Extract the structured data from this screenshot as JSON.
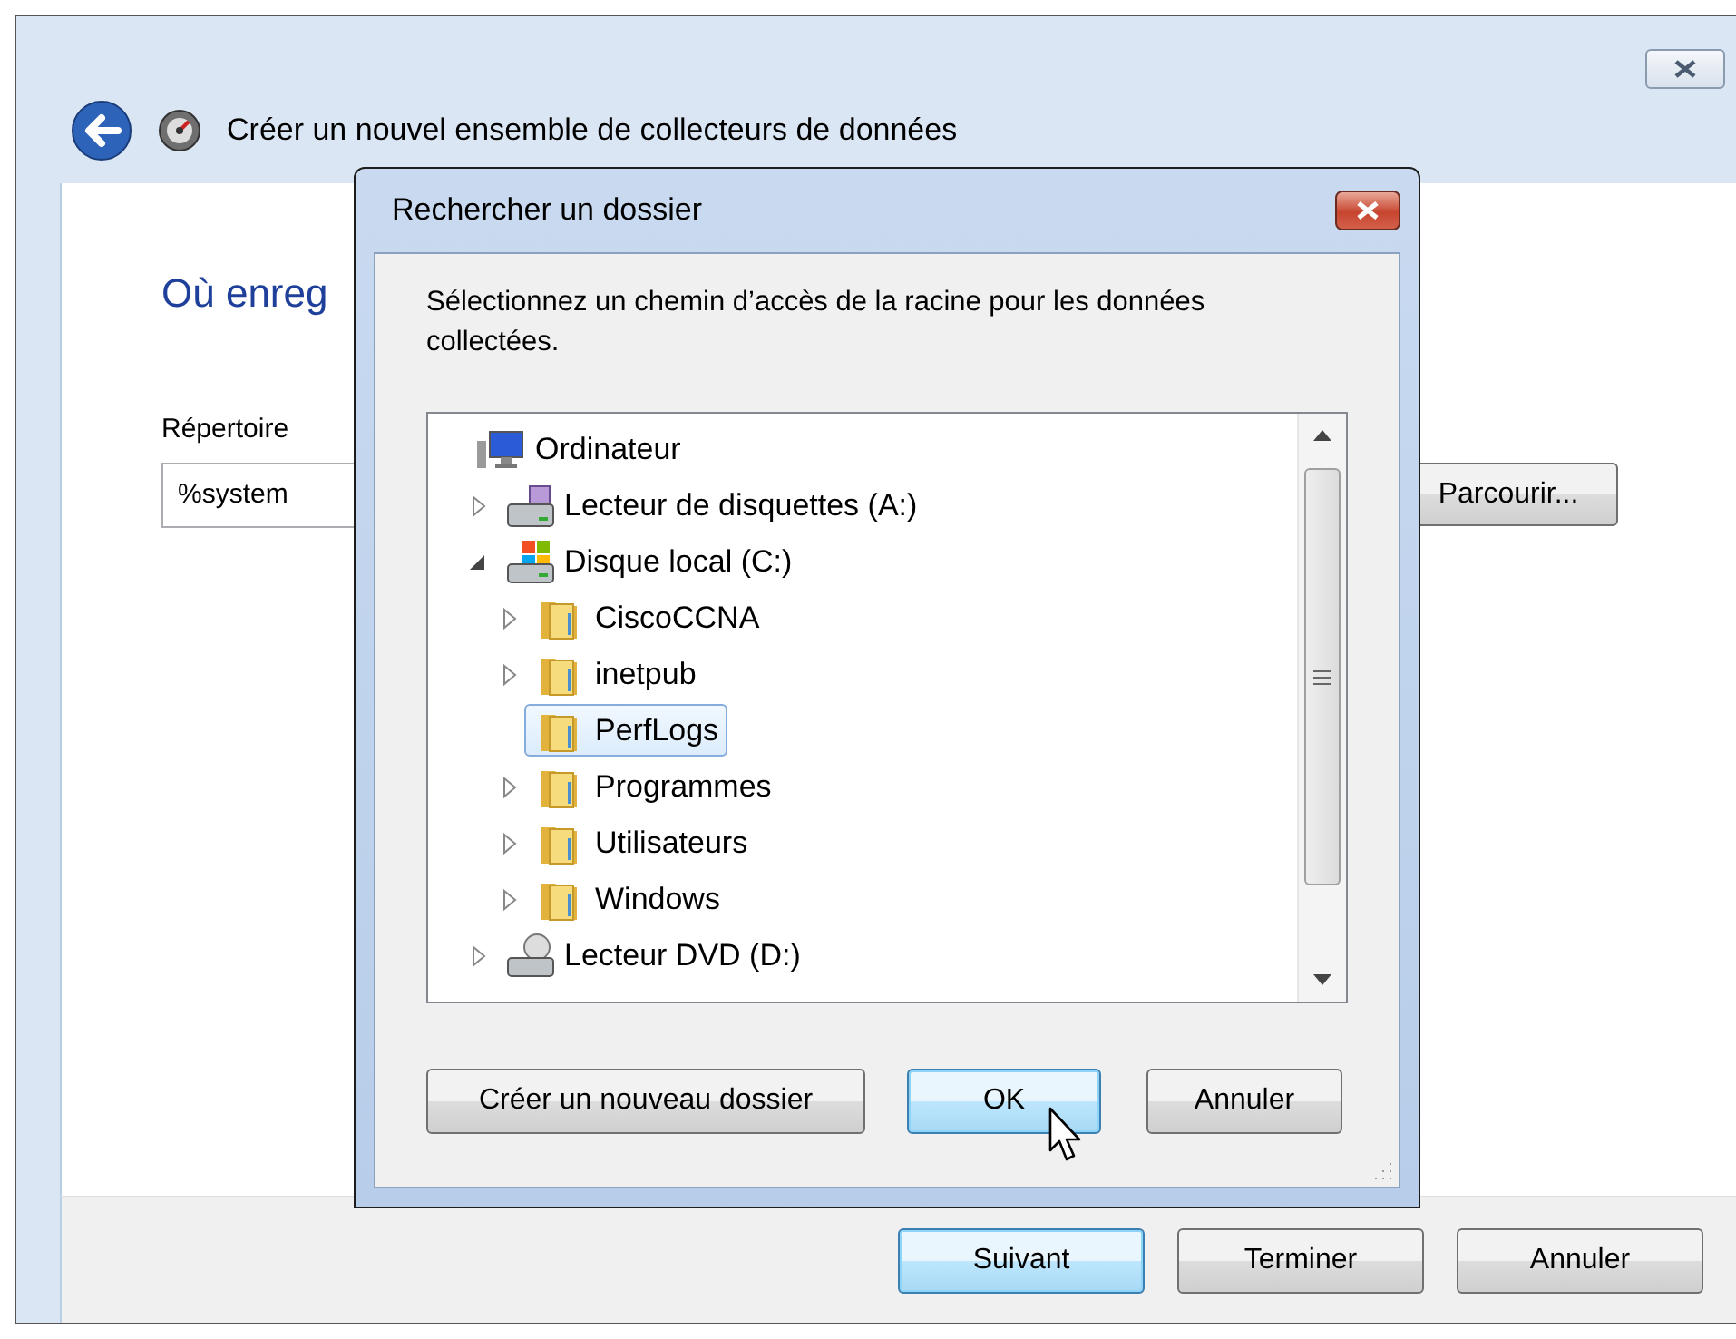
{
  "wizard": {
    "title": "Créer un nouvel ensemble de collecteurs de données",
    "heading": "Où enreg",
    "field_label": "Répertoire",
    "field_value": "%system",
    "browse_button": "Parcourir...",
    "buttons": [
      {
        "label": "Suivant",
        "default": true
      },
      {
        "label": "Terminer",
        "default": false
      },
      {
        "label": "Annuler",
        "default": false
      }
    ]
  },
  "dialog": {
    "title": "Rechercher un dossier",
    "description": "Sélectionnez un chemin d’accès de la racine pour les données collectées.",
    "tree": [
      {
        "label": "Ordinateur",
        "kind": "computer",
        "selected": false,
        "children": [
          {
            "label": "Lecteur de disquettes (A:)",
            "kind": "floppy",
            "selected": false,
            "expanded": false
          },
          {
            "label": "Disque local (C:)",
            "kind": "drive",
            "selected": false,
            "expanded": true,
            "children": [
              {
                "label": "CiscoCCNA",
                "kind": "folder",
                "selected": false,
                "expanded": false
              },
              {
                "label": "inetpub",
                "kind": "folder",
                "selected": false,
                "expanded": false
              },
              {
                "label": "PerfLogs",
                "kind": "folder",
                "selected": true
              },
              {
                "label": "Programmes",
                "kind": "folder",
                "selected": false,
                "expanded": false
              },
              {
                "label": "Utilisateurs",
                "kind": "folder",
                "selected": false,
                "expanded": false
              },
              {
                "label": "Windows",
                "kind": "folder",
                "selected": false,
                "expanded": false
              }
            ]
          },
          {
            "label": "Lecteur DVD (D:)",
            "kind": "dvd",
            "selected": false,
            "expanded": false
          }
        ]
      }
    ],
    "buttons": [
      {
        "label": "Créer un nouveau dossier",
        "default": false
      },
      {
        "label": "OK",
        "default": true
      },
      {
        "label": "Annuler",
        "default": false
      }
    ]
  }
}
